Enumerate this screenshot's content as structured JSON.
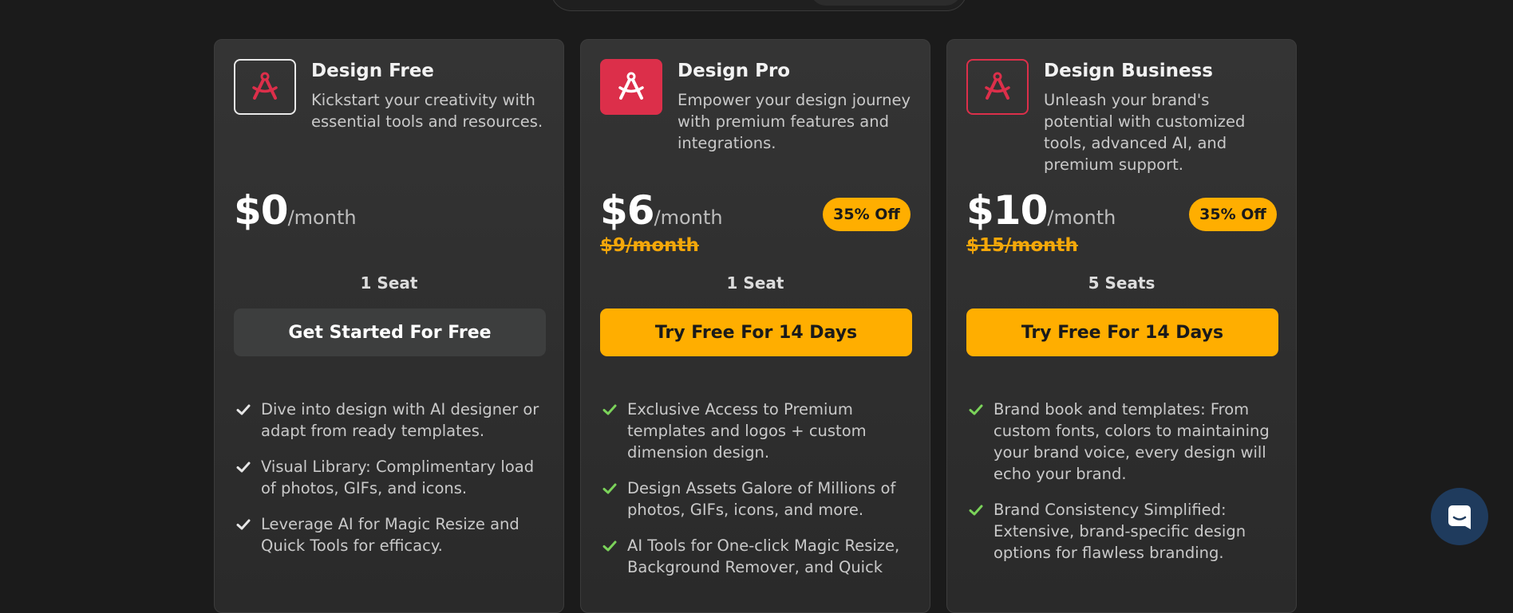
{
  "plans": [
    {
      "name": "Design Free",
      "description": "Kickstart your creativity with essential tools and resources.",
      "price": "$0",
      "period": "/month",
      "old_price": "",
      "badge": "",
      "seats": "1 Seat",
      "cta": "Get Started For Free",
      "features": [
        "Dive into design with AI designer or adapt from ready templates.",
        "Visual Library: Complimentary load of photos, GIFs, and icons.",
        "Leverage AI for Magic Resize and Quick Tools for efficacy."
      ]
    },
    {
      "name": "Design Pro",
      "description": "Empower your design journey with premium features and integrations.",
      "price": "$6",
      "period": "/month",
      "old_price": "$9/month",
      "badge": "35% Off",
      "seats": "1 Seat",
      "cta": "Try Free For 14 Days",
      "features": [
        "Exclusive Access to Premium templates and logos + custom dimension design.",
        "Design Assets Galore of Millions of photos, GIFs, icons, and more.",
        "AI Tools for One-click Magic Resize, Background Remover, and Quick"
      ]
    },
    {
      "name": "Design Business",
      "description": "Unleash your brand's potential with customized tools, advanced AI, and premium support.",
      "price": "$10",
      "period": "/month",
      "old_price": "$15/month",
      "badge": "35% Off",
      "seats": "5 Seats",
      "cta": "Try Free For 14 Days",
      "features": [
        "Brand book and templates: From custom fonts, colors to maintaining your brand voice, every design will echo your brand.",
        "Brand Consistency Simplified: Extensive, brand-specific design options for flawless branding."
      ]
    }
  ],
  "colors": {
    "accent_amber": "#ffae00",
    "brand_red": "#dc2f4a",
    "check_green": "#7bd35a",
    "check_white": "#e6e6e6"
  },
  "icons": {
    "logo": "compass-logo-icon",
    "check": "check-icon",
    "chat": "chat-icon"
  }
}
